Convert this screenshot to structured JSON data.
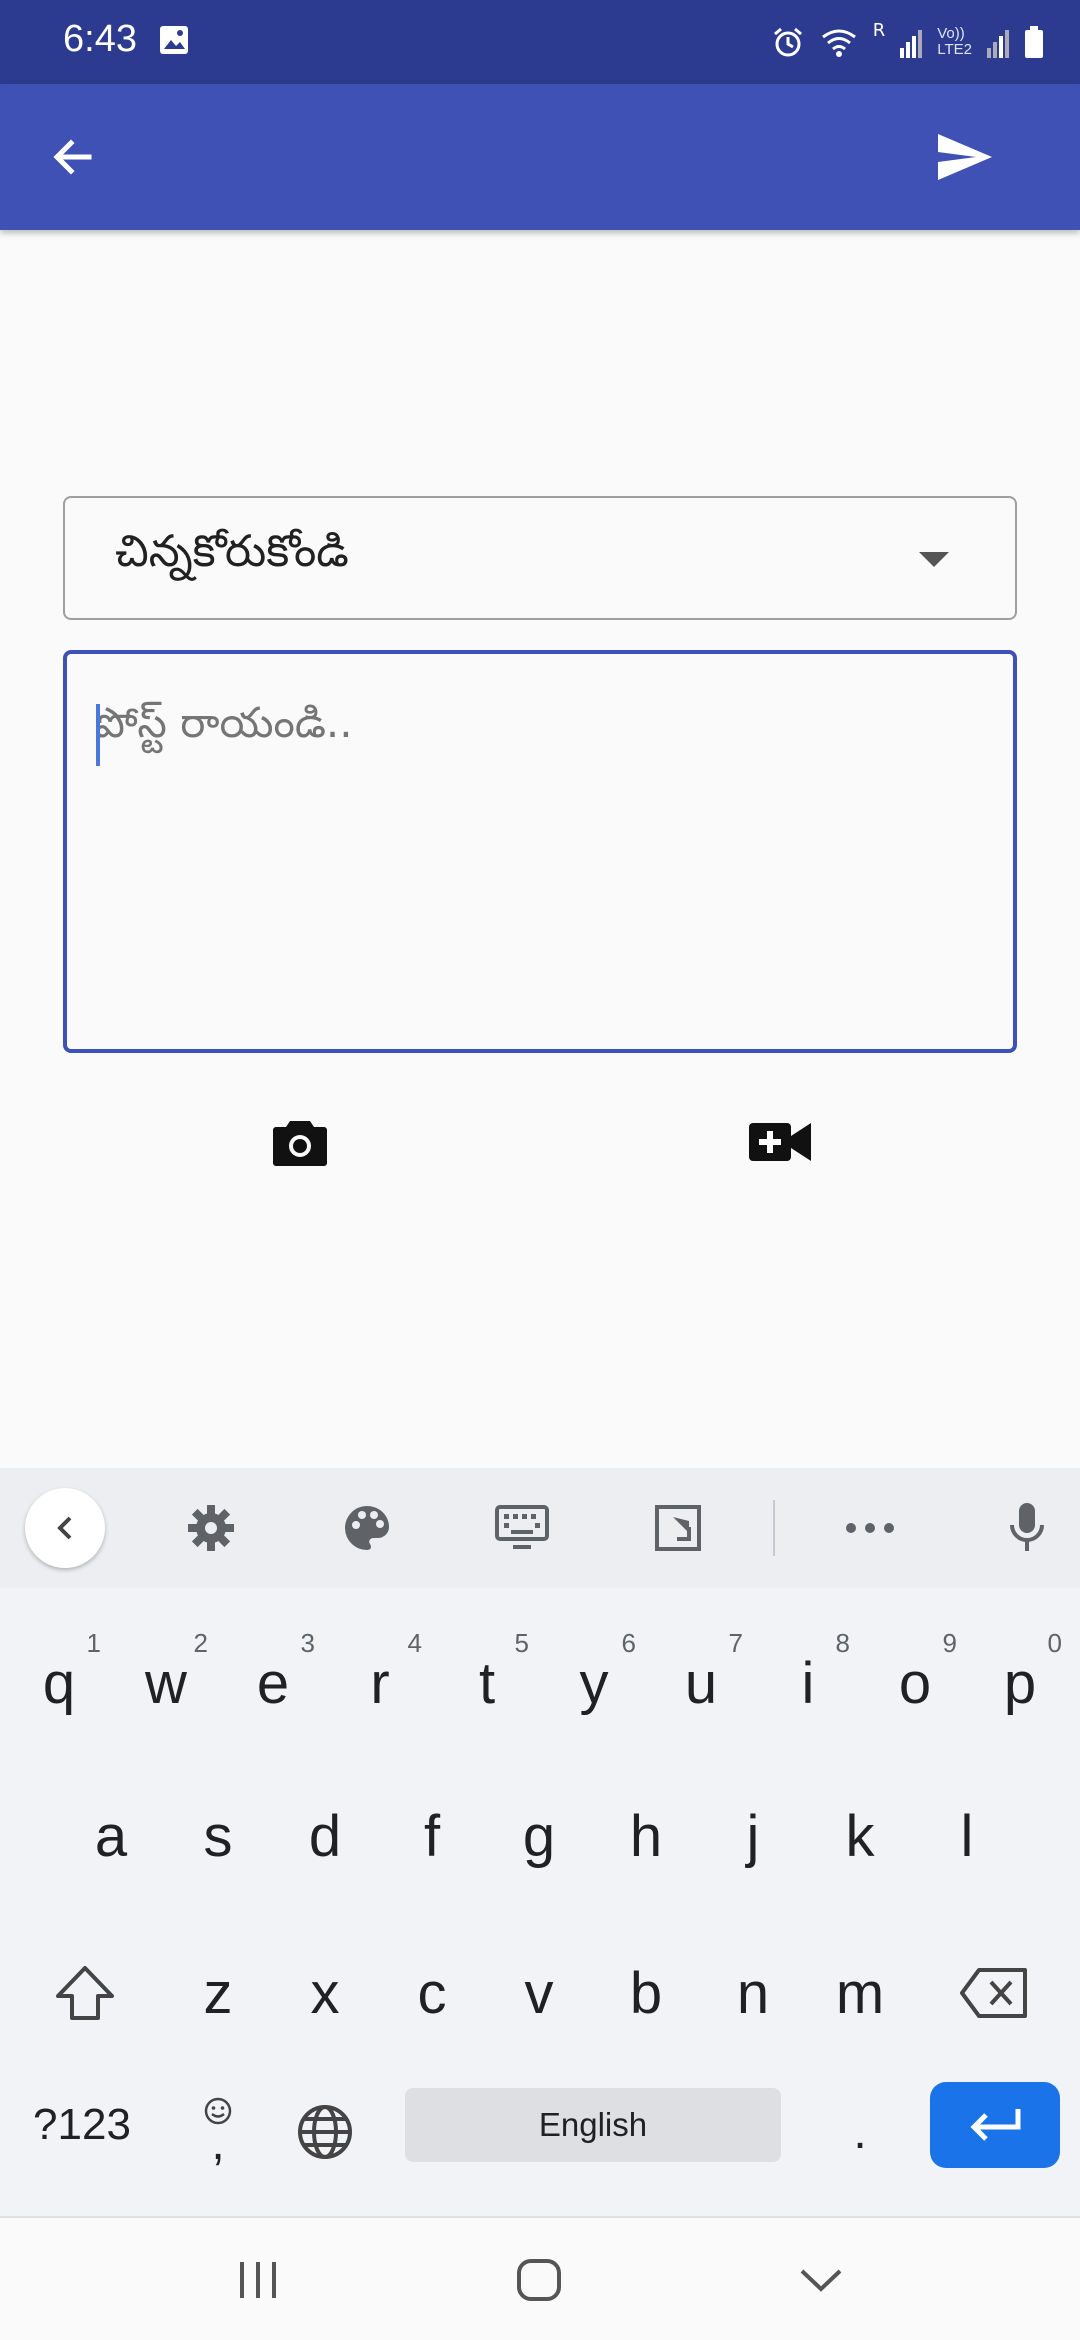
{
  "status_bar": {
    "time": "6:43",
    "network": [
      "Vo))",
      "LTE2"
    ],
    "roaming": "R",
    "icons": [
      "gallery-icon",
      "alarm-icon",
      "wifi-icon",
      "signal-icon",
      "battery-icon"
    ]
  },
  "app_bar": {
    "background": "#3f51b5",
    "back_icon": "arrow-left-icon",
    "send_icon": "send-icon"
  },
  "form": {
    "location_selected": "చిన్నకోరుకోండి",
    "post_placeholder": "పోస్ట్ రాయండి..",
    "post_value": ""
  },
  "media": {
    "camera_icon": "camera-icon",
    "video_icon": "video-add-icon"
  },
  "keyboard": {
    "toolbar_icons": [
      "chevron-left-icon",
      "gear-icon",
      "palette-icon",
      "keyboard-icon",
      "resize-icon",
      "more-icon",
      "mic-icon"
    ],
    "row1": [
      {
        "label": "q",
        "hint": "1"
      },
      {
        "label": "w",
        "hint": "2"
      },
      {
        "label": "e",
        "hint": "3"
      },
      {
        "label": "r",
        "hint": "4"
      },
      {
        "label": "t",
        "hint": "5"
      },
      {
        "label": "y",
        "hint": "6"
      },
      {
        "label": "u",
        "hint": "7"
      },
      {
        "label": "i",
        "hint": "8"
      },
      {
        "label": "o",
        "hint": "9"
      },
      {
        "label": "p",
        "hint": "0"
      }
    ],
    "row2": [
      "a",
      "s",
      "d",
      "f",
      "g",
      "h",
      "j",
      "k",
      "l"
    ],
    "row3": [
      "z",
      "x",
      "c",
      "v",
      "b",
      "n",
      "m"
    ],
    "symbols_label": "?123",
    "comma_label": ",",
    "space_label": "English",
    "period_label": ".",
    "enter_color": "#1a73e8"
  },
  "nav_bar": {
    "icons": [
      "recents-icon",
      "home-icon",
      "hide-keyboard-icon"
    ]
  }
}
